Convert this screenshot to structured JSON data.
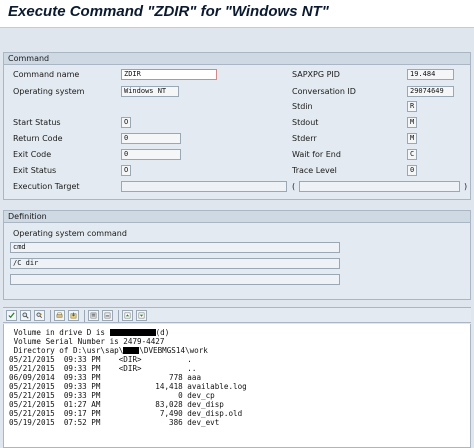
{
  "title": "Execute Command \"ZDIR\" for \"Windows NT\"",
  "command_group": {
    "heading": "Command",
    "command_name": {
      "label": "Command name",
      "value": "ZDIR"
    },
    "operating_system": {
      "label": "Operating system",
      "value": "Windows NT"
    },
    "start_status": {
      "label": "Start Status",
      "value": "O"
    },
    "return_code": {
      "label": "Return Code",
      "value": "0"
    },
    "exit_code": {
      "label": "Exit Code",
      "value": "0"
    },
    "exit_status": {
      "label": "Exit Status",
      "value": "O"
    },
    "execution_target": {
      "label": "Execution Target",
      "value": "",
      "open_paren": "(",
      "close_paren": ")"
    },
    "sapxpg_pid": {
      "label": "SAPXPG PID",
      "value": "19.484"
    },
    "conversation_id": {
      "label": "Conversation ID",
      "value": "29074649"
    },
    "stdin": {
      "label": "Stdin",
      "value": "R"
    },
    "stdout": {
      "label": "Stdout",
      "value": "M"
    },
    "stderr": {
      "label": "Stderr",
      "value": "M"
    },
    "wait_for_end": {
      "label": "Wait for End",
      "value": "C"
    },
    "trace_level": {
      "label": "Trace Level",
      "value": "0"
    }
  },
  "definition_group": {
    "heading": "Definition",
    "os_command_label": "Operating system command",
    "os_command": "cmd",
    "parameters": "/C dir",
    "additional": ""
  },
  "toolbar_icons": [
    "check-icon",
    "find-icon",
    "find-next-icon",
    "print-icon",
    "download-icon",
    "select-all-icon",
    "deselect-all-icon",
    "page-up-icon",
    "page-down-icon"
  ],
  "output": {
    "vol_prefix": " Volume in drive D is ",
    "vol_suffix": "(d)",
    "serial": " Volume Serial Number is 2479-4427",
    "dir_prefix": " Directory of D:\\usr\\sap\\",
    "dir_suffix": "\\DVEBMGS14\\work",
    "rows": [
      "05/21/2015  09:33 PM    <DIR>          .",
      "05/21/2015  09:33 PM    <DIR>          ..",
      "06/09/2014  09:33 PM               778 aaa",
      "05/21/2015  09:33 PM            14,418 available.log",
      "05/21/2015  09:33 PM                 0 dev_cp",
      "05/21/2015  01:27 AM            83,028 dev_disp",
      "05/21/2015  09:17 PM             7,490 dev_disp.old",
      "05/19/2015  07:52 PM               386 dev_evt"
    ]
  }
}
